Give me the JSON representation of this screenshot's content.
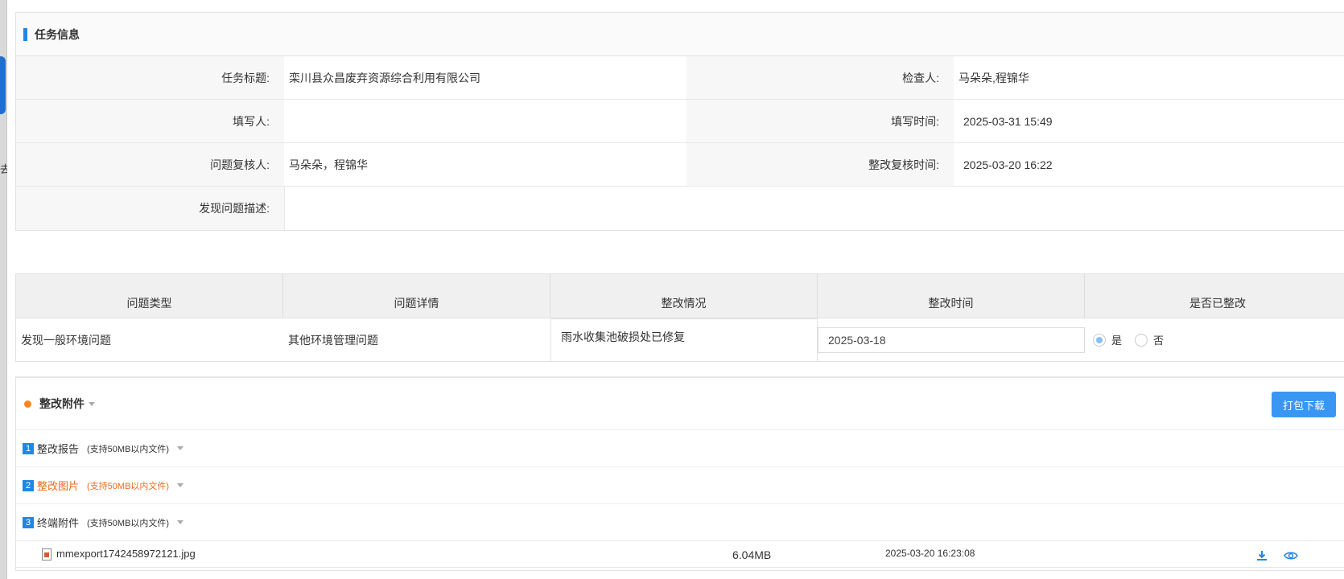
{
  "side": {
    "glyph": "去"
  },
  "task_info": {
    "header": "任务信息",
    "rows": [
      {
        "label1": "任务标题:",
        "value1": "栾川县众昌废弃资源综合利用有限公司",
        "label2": "检查人:",
        "value2": "马朵朵,程锦华"
      },
      {
        "label1": "填写人:",
        "value1": "",
        "label2": "填写时间:",
        "value2": "2025-03-31 15:49"
      },
      {
        "label1": "问题复核人:",
        "value1": "马朵朵，程锦华",
        "label2": "整改复核时间:",
        "value2": "2025-03-20 16:22"
      }
    ],
    "desc_label": "发现问题描述:",
    "desc_value": ""
  },
  "problem_table": {
    "headers": [
      "问题类型",
      "问题详情",
      "整改情况",
      "整改时间",
      "是否已整改"
    ],
    "row": {
      "type": "发现一般环境问题",
      "detail": "其他环境管理问题",
      "situation": "雨水收集池破损处已修复",
      "time": "2025-03-18",
      "yes_label": "是",
      "no_label": "否",
      "selected": "是"
    }
  },
  "attachments": {
    "title": "整改附件",
    "pack_button": "打包下载",
    "categories": [
      {
        "num": "1",
        "name": "整改报告",
        "hint": "(支持50MB以内文件)"
      },
      {
        "num": "2",
        "name": "整改图片",
        "hint": "(支持50MB以内文件)"
      },
      {
        "num": "3",
        "name": "终端附件",
        "hint": "(支持50MB以内文件)"
      }
    ],
    "file": {
      "name": "mmexport1742458972121.jpg",
      "size": "6.04MB",
      "time": "2025-03-20 16:23:08"
    }
  }
}
